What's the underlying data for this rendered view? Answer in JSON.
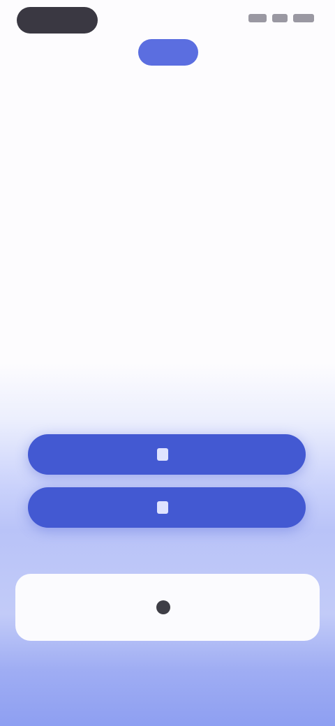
{
  "status_bar": {
    "time_pill": "",
    "signal_icon": "signal-icon",
    "wifi_icon": "wifi-icon",
    "battery_icon": "battery-icon"
  },
  "logo": {
    "label": "",
    "color": "#5b6ee0"
  },
  "hero": {
    "title": "",
    "subtitle": ""
  },
  "buttons": [
    {
      "label": "",
      "icon": "button-icon"
    },
    {
      "label": "",
      "icon": "button-icon"
    }
  ],
  "secondary_link": "",
  "card": {
    "label": "",
    "icon": "card-icon"
  },
  "footer": "",
  "colors": {
    "primary": "#4359d2",
    "gradient_bottom": "#8e9ff2",
    "text_dark": "#4a4a52",
    "text_muted": "#a8a4b2"
  }
}
